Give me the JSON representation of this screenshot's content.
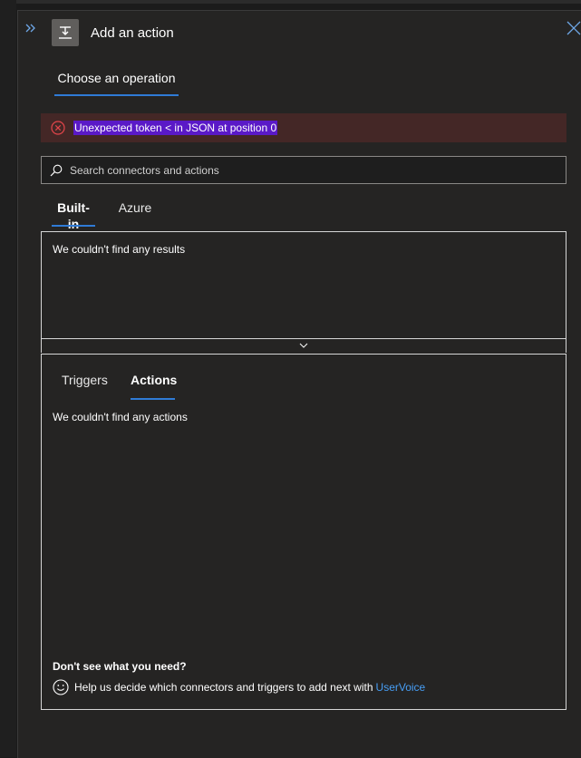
{
  "header": {
    "title": "Add an action",
    "icons": {
      "expand": "double-chevron-right-icon",
      "action": "action-step-icon",
      "close": "close-icon"
    }
  },
  "operation_tab": {
    "label": "Choose an operation"
  },
  "error": {
    "message": "Unexpected token < in JSON at position 0",
    "icon": "error-circle-icon"
  },
  "search": {
    "placeholder": "Search connectors and actions",
    "value": ""
  },
  "category_tabs": [
    {
      "label": "Built-in",
      "active": true
    },
    {
      "label": "Azure",
      "active": false
    }
  ],
  "results": {
    "message": "We couldn't find any results"
  },
  "sub_tabs": [
    {
      "label": "Triggers",
      "active": false
    },
    {
      "label": "Actions",
      "active": true
    }
  ],
  "actions": {
    "message": "We couldn't find any actions"
  },
  "footer": {
    "title": "Don't see what you need?",
    "text": "Help us decide which connectors and triggers to add next with",
    "link": "UserVoice"
  },
  "colors": {
    "accent": "#2f7bd6",
    "error_bg": "#442726",
    "error_icon": "#e3454a",
    "selection": "#5a19c7",
    "link": "#479ef5",
    "panel_bg": "#252423"
  }
}
